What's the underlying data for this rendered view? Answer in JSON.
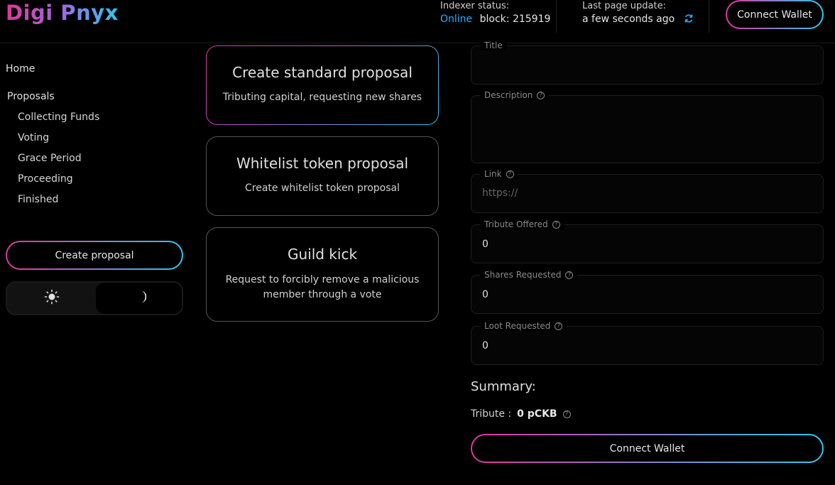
{
  "app": {
    "logo": "Digi Pnyx"
  },
  "header": {
    "indexer_label": "Indexer status:",
    "indexer_state": "Online",
    "block_text": "block: 215919",
    "update_label": "Last page update:",
    "update_value": "a few seconds ago",
    "connect_wallet": "Connect Wallet"
  },
  "sidebar": {
    "home": "Home",
    "proposals": "Proposals",
    "items": [
      "Collecting Funds",
      "Voting",
      "Grace Period",
      "Proceeding",
      "Finished"
    ],
    "create_button": "Create proposal",
    "theme_light_icon": "sun-icon",
    "theme_dark_icon": "moon-icon"
  },
  "cards": [
    {
      "title": "Create standard proposal",
      "desc": "Tributing capital, requesting new shares"
    },
    {
      "title": "Whitelist token proposal",
      "desc": "Create whitelist token proposal"
    },
    {
      "title": "Guild kick",
      "desc": "Request to forcibly remove a malicious member through a vote"
    }
  ],
  "form": {
    "title_label": "Title",
    "description_label": "Description",
    "link_label": "Link",
    "link_placeholder": "https://",
    "tribute_label": "Tribute Offered",
    "tribute_value": "0",
    "shares_label": "Shares Requested",
    "shares_value": "0",
    "loot_label": "Loot Requested",
    "loot_value": "0"
  },
  "summary": {
    "title": "Summary:",
    "tribute_label": "Tribute :",
    "tribute_value": "0 pCKB",
    "connect_wallet": "Connect Wallet"
  },
  "colors": {
    "accent_pink": "#e0359a",
    "accent_cyan": "#2ec8f0",
    "online": "#2fa9ff"
  }
}
